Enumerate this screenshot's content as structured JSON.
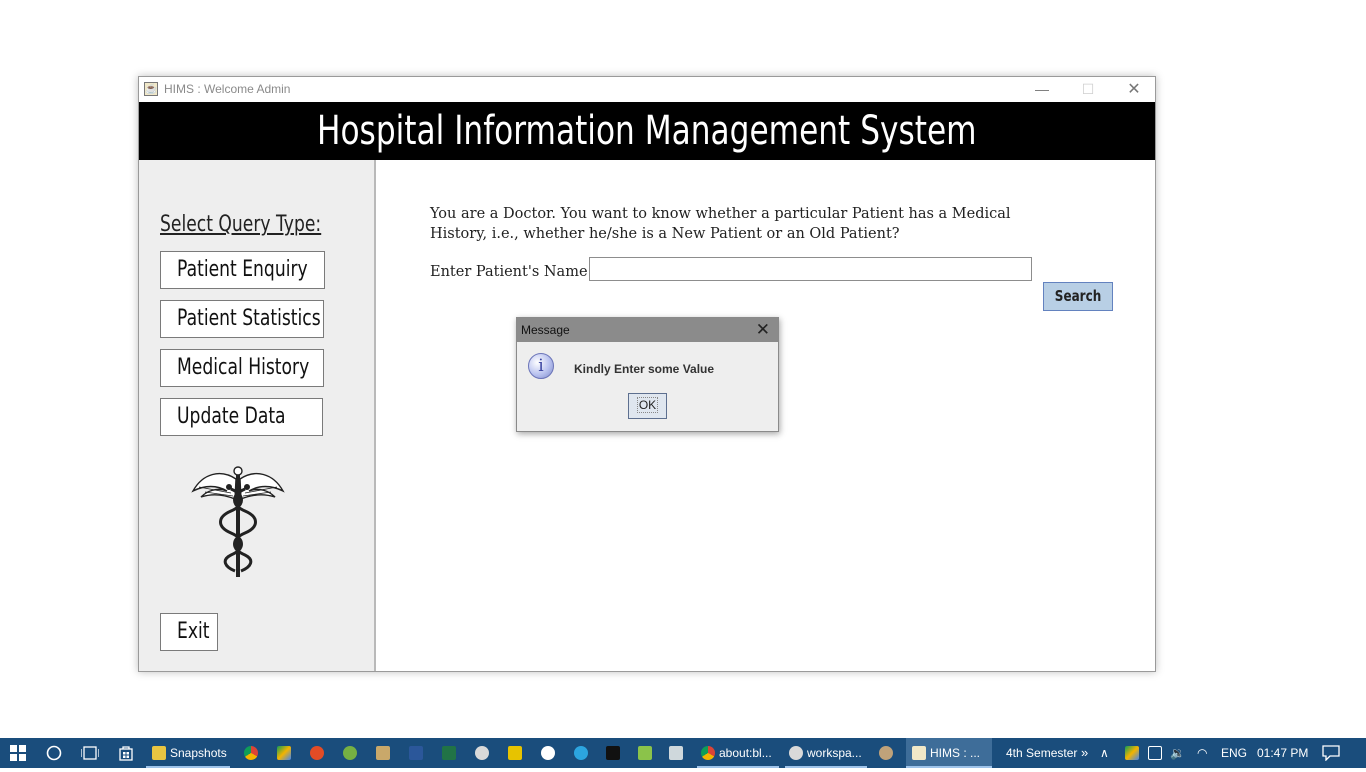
{
  "window": {
    "title": "HIMS : Welcome Admin",
    "minimize_glyph": "—",
    "maximize_glyph": "☐",
    "close_glyph": "✕"
  },
  "banner": {
    "title": "Hospital Information Management System"
  },
  "sidebar": {
    "label": "Select Query Type:",
    "buttons": [
      {
        "label": "Patient Enquiry"
      },
      {
        "label": "Patient Statistics"
      },
      {
        "label": "Medical History"
      },
      {
        "label": "Update Data"
      }
    ],
    "logo_icon": "caduceus-icon",
    "exit_label": "Exit"
  },
  "content": {
    "question": "You are a Doctor. You want to know whether a particular Patient has a Medical History, i.e., whether he/she is a New Patient or an Old Patient?",
    "name_label": "Enter Patient's Name:",
    "name_value": "",
    "search_label": "Search"
  },
  "dialog": {
    "title": "Message",
    "message": "Kindly Enter some Value",
    "ok_label": "OK",
    "icon": "info-icon",
    "icon_glyph": "i"
  },
  "taskbar": {
    "apps": [
      {
        "label": "Snapshots"
      },
      {
        "label": "about:bl..."
      },
      {
        "label": "workspa..."
      },
      {
        "label": "HIMS : ..."
      }
    ],
    "folder_label": "4th Semester",
    "language": "ENG",
    "time": "01:47 PM",
    "accent": "#1a4d7c"
  }
}
